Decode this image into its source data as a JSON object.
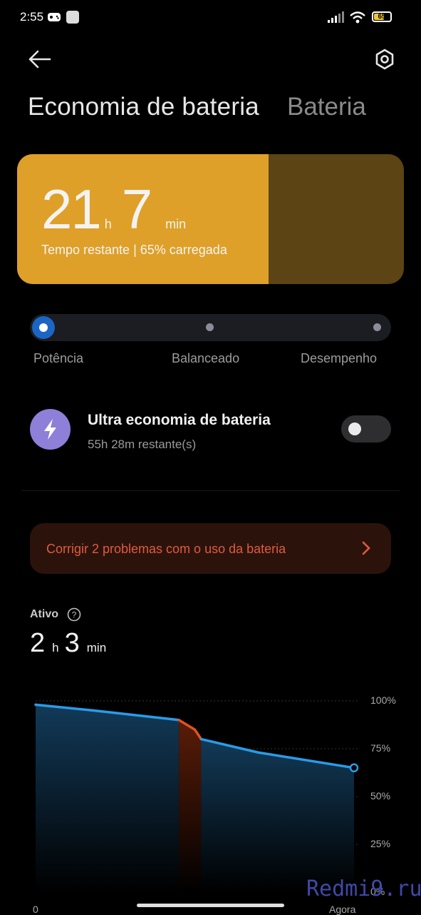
{
  "status_bar": {
    "time": "2:55",
    "battery_level": "65"
  },
  "header": {
    "tab_active": "Economia de bateria",
    "tab_inactive": "Bateria",
    "back_icon": "arrow-left-icon",
    "settings_icon": "hexagon-settings-icon"
  },
  "battery_card": {
    "hours": "21",
    "hours_unit": "h",
    "minutes": "7",
    "minutes_unit": "min",
    "subtitle": "Tempo restante | 65% carregada",
    "charge_fraction": 0.65,
    "accent_color": "#dea028",
    "track_color": "#5c4414"
  },
  "power_modes": {
    "selected": "Potência",
    "options": [
      "Potência",
      "Balanceado",
      "Desempenho"
    ]
  },
  "ultra_saver": {
    "title": "Ultra economia de bateria",
    "subtitle": "55h 28m restante(s)",
    "icon": "lightning-bolt-icon",
    "enabled": false
  },
  "fix_banner": {
    "text": "Corrigir 2 problemas com o uso da bateria",
    "color": "#e05a3e"
  },
  "active_usage": {
    "label": "Ativo",
    "hours": "2",
    "hours_unit": "h",
    "minutes": "3",
    "minutes_unit": "min"
  },
  "chart_data": {
    "type": "area",
    "y_ticks": [
      "100%",
      "75%",
      "50%",
      "25%",
      "0%"
    ],
    "x_labels": [
      "0",
      "Agora"
    ],
    "ylim": [
      0,
      100
    ],
    "series": [
      {
        "color": "#2a9be8",
        "points": [
          [
            0,
            98
          ],
          [
            0.18,
            95
          ],
          [
            0.45,
            90
          ]
        ]
      },
      {
        "color": "#e0531e",
        "points": [
          [
            0.45,
            90
          ],
          [
            0.5,
            85
          ],
          [
            0.52,
            80
          ]
        ]
      },
      {
        "color": "#2a9be8",
        "points": [
          [
            0.52,
            80
          ],
          [
            0.7,
            73
          ],
          [
            1.0,
            65
          ]
        ]
      }
    ]
  },
  "watermark": "Redmi9.ru"
}
